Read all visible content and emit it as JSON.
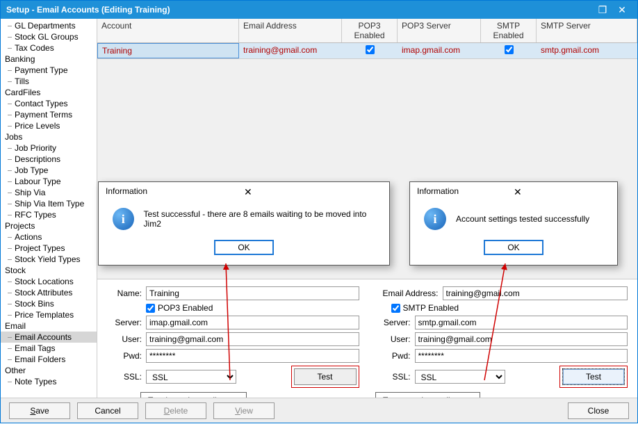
{
  "window": {
    "title": "Setup - Email Accounts (Editing Training)"
  },
  "tree": {
    "groups": [
      {
        "label": "",
        "children": [
          "GL Departments",
          "Stock GL Groups",
          "Tax Codes"
        ]
      },
      {
        "label": "Banking",
        "children": [
          "Payment Type",
          "Tills"
        ]
      },
      {
        "label": "CardFiles",
        "children": [
          "Contact Types",
          "Payment Terms",
          "Price Levels"
        ]
      },
      {
        "label": "Jobs",
        "children": [
          "Job Priority",
          "Descriptions",
          "Job Type",
          "Labour Type",
          "Ship Via",
          "Ship Via Item Type",
          "RFC Types"
        ]
      },
      {
        "label": "Projects",
        "children": [
          "Actions",
          "Project Types",
          "Stock Yield Types"
        ]
      },
      {
        "label": "Stock",
        "children": [
          "Stock Locations",
          "Stock Attributes",
          "Stock Bins",
          "Price Templates"
        ]
      },
      {
        "label": "Email",
        "children": [
          "Email Accounts",
          "Email Tags",
          "Email Folders"
        ]
      },
      {
        "label": "Other",
        "children": [
          "Note Types"
        ]
      }
    ],
    "selected": "Email Accounts"
  },
  "grid": {
    "headers": {
      "account": "Account",
      "email": "Email Address",
      "pop3en": "POP3 Enabled",
      "pop3srv": "POP3 Server",
      "smtpen": "SMTP Enabled",
      "smtpsrv": "SMTP Server"
    },
    "row": {
      "account": "Training",
      "email": "training@gmail.com",
      "pop3en": true,
      "pop3srv": "imap.gmail.com",
      "smtpen": true,
      "smtpsrv": "smtp.gmail.com"
    }
  },
  "form": {
    "name_label": "Name:",
    "name": "Training",
    "emailaddr_label": "Email Address:",
    "emailaddr": "training@gmail.com",
    "pop3_enabled_label": "POP3 Enabled",
    "smtp_enabled_label": "SMTP Enabled",
    "server_label": "Server:",
    "user_label": "User:",
    "pwd_label": "Pwd:",
    "ssl_label": "SSL:",
    "pop3": {
      "server": "imap.gmail.com",
      "user": "training@gmail.com",
      "pwd": "********",
      "ssl": "SSL"
    },
    "smtp": {
      "server": "smtp.gmail.com",
      "user": "training@gmail.com",
      "pwd": "********",
      "ssl": "SSL"
    },
    "test_label": "Test",
    "callout_in": "Test incoming mail setup",
    "callout_out": "Test outgoing mail setup"
  },
  "dialogs": {
    "info_title": "Information",
    "ok": "OK",
    "msg1": "Test successful - there are 8 emails waiting to be moved into Jim2",
    "msg2": "Account settings tested successfully"
  },
  "footer": {
    "save": "Save",
    "cancel": "Cancel",
    "delete": "Delete",
    "view": "View",
    "close": "Close"
  }
}
